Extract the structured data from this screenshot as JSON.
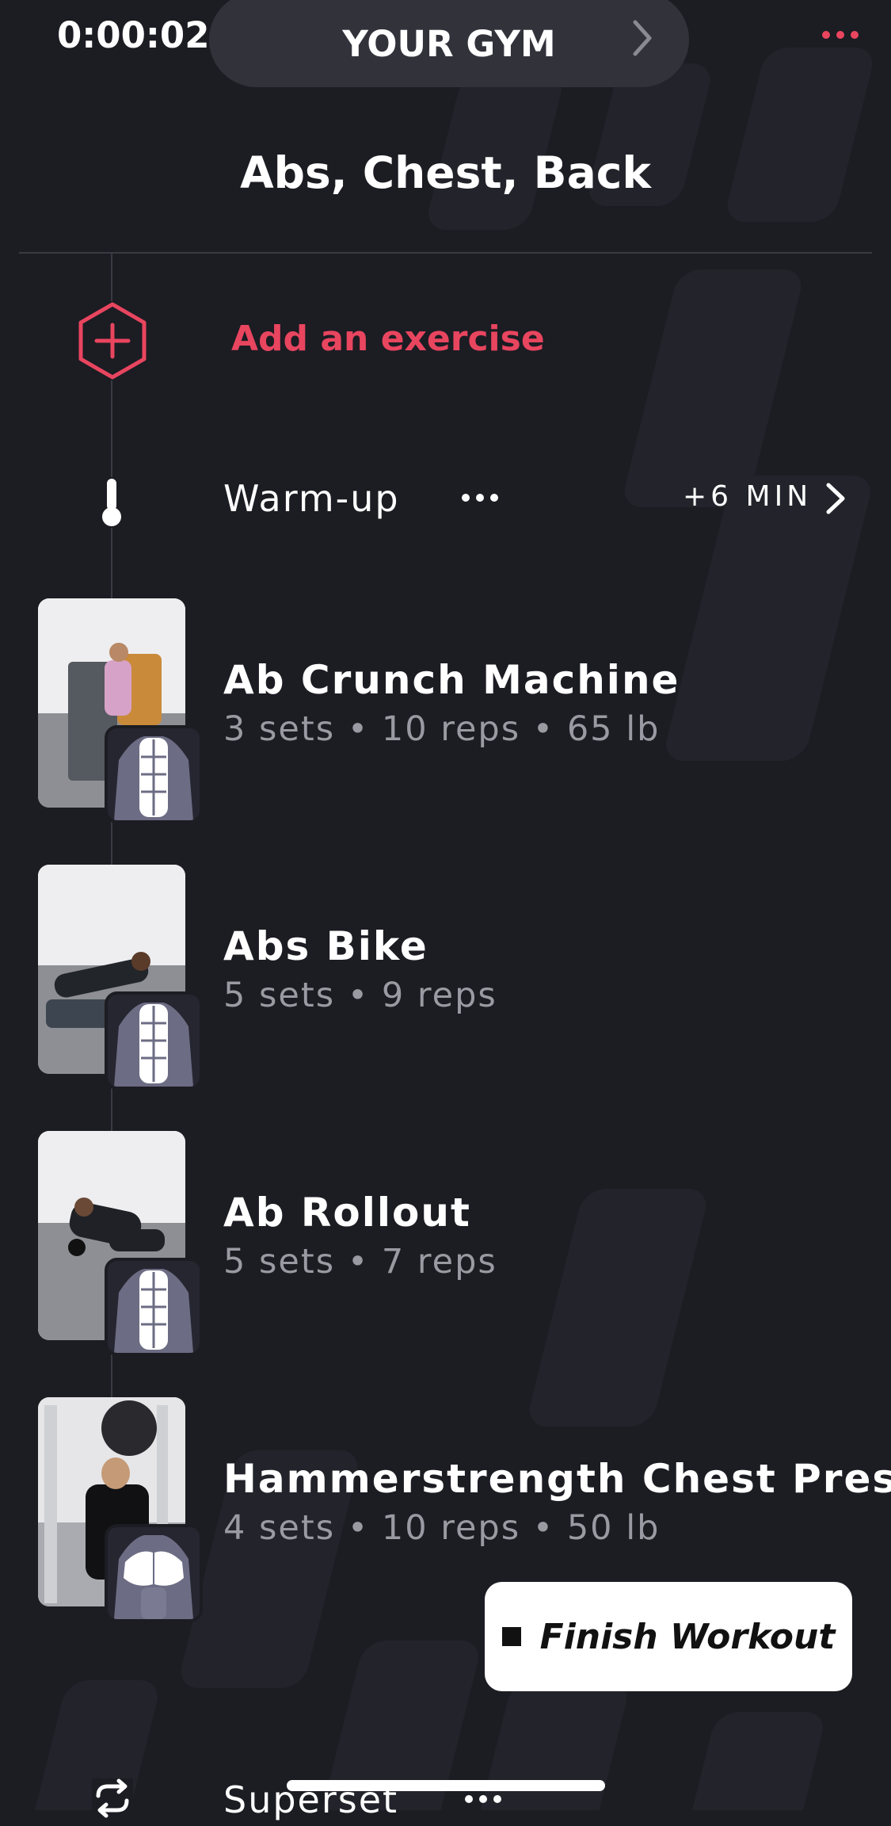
{
  "status": {
    "timer": "0:00:02"
  },
  "header": {
    "gym_label": "YOUR GYM"
  },
  "workout": {
    "title": "Abs, Chest, Back"
  },
  "add_exercise": {
    "label": "Add an exercise"
  },
  "warmup": {
    "label": "Warm-up",
    "duration": "+6 MIN"
  },
  "exercises": [
    {
      "name": "Ab Crunch Machine",
      "detail": "3 sets • 10 reps • 65 lb",
      "muscle": "abs"
    },
    {
      "name": "Abs Bike",
      "detail": "5 sets • 9 reps",
      "muscle": "abs"
    },
    {
      "name": "Ab Rollout",
      "detail": "5 sets • 7 reps",
      "muscle": "abs"
    },
    {
      "name": "Hammerstrength Chest Press",
      "detail": "4 sets • 10 reps • 50 lb",
      "muscle": "chest"
    }
  ],
  "finish_button": {
    "label": "Finish Workout"
  },
  "superset": {
    "label": "Superset"
  },
  "colors": {
    "accent": "#e8455f",
    "background": "#1c1c23",
    "pill": "#32323b",
    "muted_text": "#9a9aa3"
  },
  "icons": [
    "chevron-right-icon",
    "more-dots-icon",
    "add-hexagon-icon",
    "thermometer-icon",
    "abs-muscle-icon",
    "chest-muscle-icon",
    "stop-icon",
    "superset-cycle-icon"
  ]
}
